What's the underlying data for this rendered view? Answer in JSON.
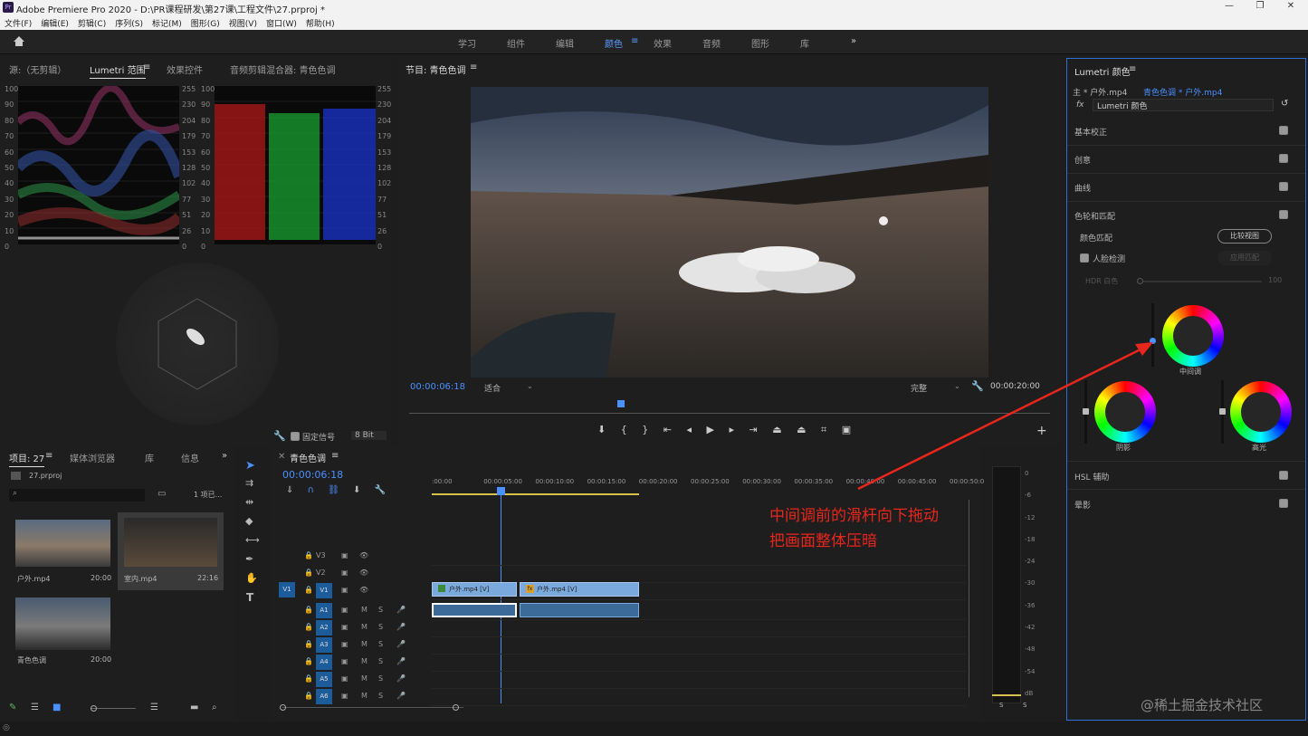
{
  "titlebar": {
    "app_icon": "Pr",
    "title": "Adobe Premiere Pro 2020 - D:\\PR课程研发\\第27课\\工程文件\\27.prproj *"
  },
  "menu": [
    "文件(F)",
    "编辑(E)",
    "剪辑(C)",
    "序列(S)",
    "标记(M)",
    "图形(G)",
    "视图(V)",
    "窗口(W)",
    "帮助(H)"
  ],
  "workspaces": [
    "学习",
    "组件",
    "编辑",
    "颜色",
    "效果",
    "音频",
    "图形",
    "库"
  ],
  "workspace_active": "颜色",
  "source_panel": {
    "tabs": [
      "源:（无剪辑）",
      "Lumetri 范围",
      "效果控件",
      "音频剪辑混合器: 青色色调"
    ],
    "active": "Lumetri 范围",
    "scale_left": [
      "100",
      "90",
      "80",
      "70",
      "60",
      "50",
      "40",
      "30",
      "20",
      "10",
      "0"
    ],
    "scale_mid": [
      "255",
      "230",
      "204",
      "179",
      "153",
      "128",
      "102",
      "77",
      "51",
      "26",
      "0"
    ],
    "scale_right": [
      "100",
      "90",
      "80",
      "70",
      "60",
      "50",
      "40",
      "30",
      "20",
      "10",
      "0"
    ],
    "scale_far": [
      "255",
      "230",
      "204",
      "179",
      "153",
      "128",
      "102",
      "77",
      "51",
      "26",
      "0"
    ],
    "clamp_label": "固定信号",
    "bit_label": "8 Bit"
  },
  "program_panel": {
    "title": "节目: 青色色调",
    "timecode": "00:00:06:18",
    "fit": "适合",
    "quality": "完整",
    "duration": "00:00:20:00"
  },
  "lumetri": {
    "title": "Lumetri 颜色",
    "master": "主 * 户外.mp4",
    "clip": "青色色调 * 户外.mp4",
    "effect": "Lumetri 颜色",
    "sections": [
      "基本校正",
      "创意",
      "曲线",
      "色轮和匹配"
    ],
    "color_match": "颜色匹配",
    "compare_view": "比较视图",
    "face_detect": "人脸检测",
    "apply_match": "应用匹配",
    "hdr_white": "HDR 白色",
    "hdr_value": "100",
    "wheel_mid": "中间调",
    "wheel_shadow": "阴影",
    "wheel_high": "高光",
    "hsl": "HSL 辅助",
    "vignette": "晕影"
  },
  "project_panel": {
    "tabs": [
      "项目: 27",
      "媒体浏览器",
      "库",
      "信息"
    ],
    "file": "27.prproj",
    "count": "1 项已...",
    "items": [
      {
        "name": "户外.mp4",
        "dur": "20:00"
      },
      {
        "name": "室内.mp4",
        "dur": "22:16"
      },
      {
        "name": "青色色调",
        "dur": "20:00"
      }
    ]
  },
  "timeline": {
    "title": "青色色调",
    "timecode": "00:00:06:18",
    "ruler": [
      ":00:00",
      "00:00:05:00",
      "00:00:10:00",
      "00:00:15:00",
      "00:00:20:00",
      "00:00:25:00",
      "00:00:30:00",
      "00:00:35:00",
      "00:00:40:00",
      "00:00:45:00",
      "00:00:50:0"
    ],
    "video_tracks": [
      "V3",
      "V2",
      "V1"
    ],
    "audio_tracks": [
      "A1",
      "A2",
      "A3",
      "A4",
      "A5",
      "A6"
    ],
    "clip1": "户外.mp4 [V]",
    "clip2": "户外.mp4 [V]",
    "fx": "fx"
  },
  "meter_scale": [
    "0",
    "-6",
    "-12",
    "-18",
    "-24",
    "-30",
    "-36",
    "-42",
    "-48",
    "-54",
    "dB"
  ],
  "meter_s": "S",
  "annotation": {
    "line1": "中间调前的滑杆向下拖动",
    "line2": "把画面整体压暗",
    "color": "#e8261c"
  },
  "watermark": "@稀土掘金技术社区"
}
